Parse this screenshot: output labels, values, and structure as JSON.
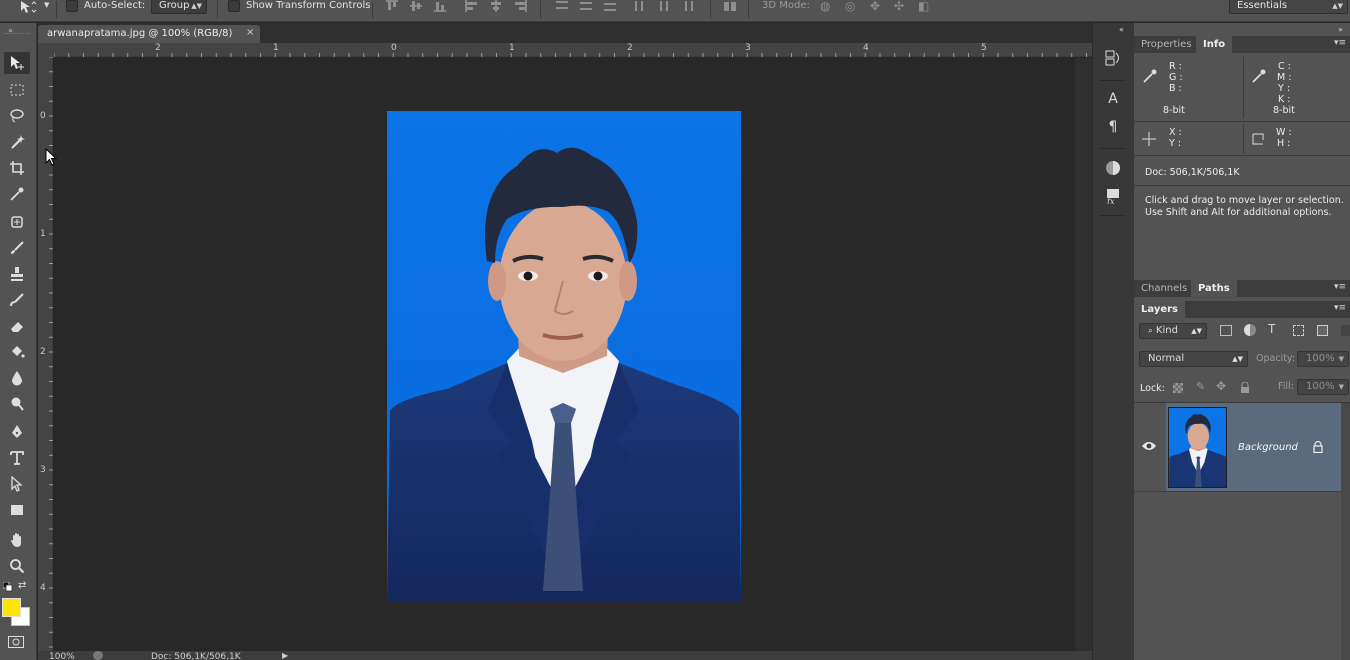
{
  "options_bar": {
    "auto_select_label": "Auto-Select:",
    "auto_select_value": "Group",
    "transform_controls_label": "Show Transform Controls",
    "mode_3d_label": "3D Mode:",
    "workspace_value": "Essentials"
  },
  "document": {
    "tab_title": "arwanapratama.jpg @ 100% (RGB/8)",
    "close_glyph": "×",
    "zoom": "100%",
    "doc_size": "Doc: 506,1K/506,1K"
  },
  "rulers": {
    "horizontal": [
      "2",
      "1",
      "0",
      "1",
      "2",
      "3",
      "4",
      "5"
    ],
    "vertical": [
      "0",
      "1",
      "2",
      "3",
      "4"
    ]
  },
  "info_panel": {
    "tabs": [
      "Properties",
      "Info"
    ],
    "active_tab": "Info",
    "rgb_labels": [
      "R :",
      "G :",
      "B :"
    ],
    "cmyk_labels": [
      "C :",
      "M :",
      "Y :",
      "K :"
    ],
    "left_bit_depth": "8-bit",
    "right_bit_depth": "8-bit",
    "xy_labels": [
      "X :",
      "Y :"
    ],
    "wh_labels": [
      "W :",
      "H :"
    ],
    "doc_size": "Doc: 506,1K/506,1K",
    "hint_line1": "Click and drag to move layer or selection.",
    "hint_line2": "Use Shift and Alt for additional options."
  },
  "paths_panel": {
    "tabs": [
      "Channels",
      "Paths"
    ],
    "active_tab": "Paths"
  },
  "layers_panel": {
    "tab": "Layers",
    "filter_value": "Kind",
    "blend_mode": "Normal",
    "opacity_label": "Opacity:",
    "opacity_value": "100%",
    "lock_label": "Lock:",
    "fill_label": "Fill:",
    "fill_value": "100%",
    "layers": [
      {
        "name": "Background",
        "visible": true,
        "locked": true
      }
    ]
  },
  "colors": {
    "foreground": "#ffe600",
    "background": "#ffffff",
    "photo_backdrop": "#0a73e5",
    "selected_layer_row": "#5c6a7d"
  }
}
